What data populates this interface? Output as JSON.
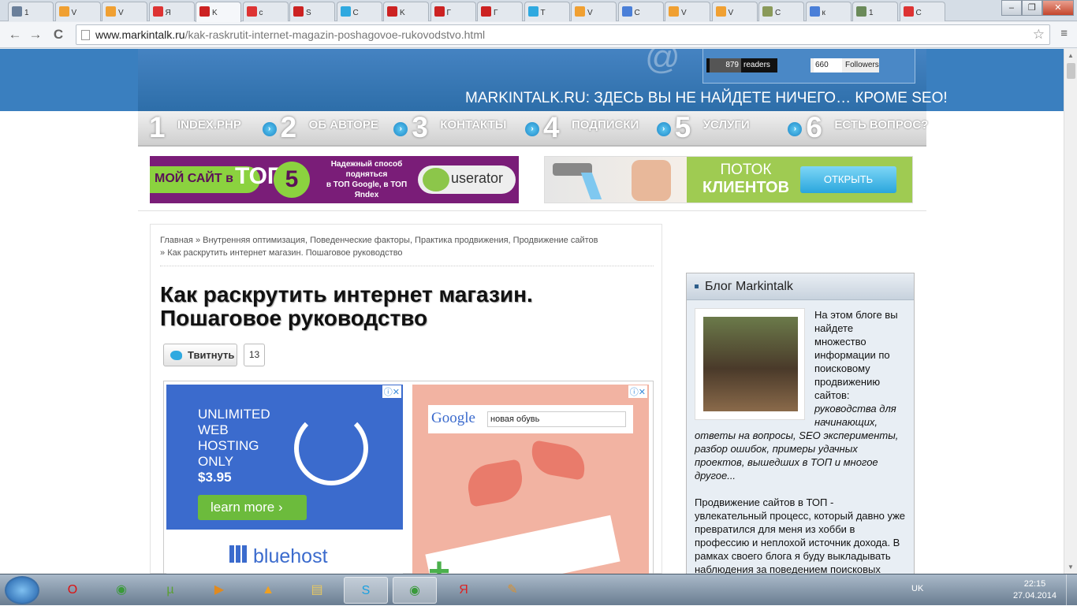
{
  "browser": {
    "tabs": [
      {
        "label": "1",
        "favicon": "#6a7f9a",
        "active": false
      },
      {
        "label": "V",
        "favicon": "#f0a032",
        "active": false
      },
      {
        "label": "V",
        "favicon": "#f0a032",
        "active": false
      },
      {
        "label": "Я",
        "favicon": "#d33",
        "active": false
      },
      {
        "label": "K",
        "favicon": "#c22",
        "active": true
      },
      {
        "label": "c",
        "favicon": "#d33",
        "active": false
      },
      {
        "label": "S",
        "favicon": "#c22",
        "active": false
      },
      {
        "label": "C",
        "favicon": "#2fa9e0",
        "active": false
      },
      {
        "label": "K",
        "favicon": "#c22",
        "active": false
      },
      {
        "label": "Г",
        "favicon": "#c22",
        "active": false
      },
      {
        "label": "Г",
        "favicon": "#c22",
        "active": false
      },
      {
        "label": "Т",
        "favicon": "#2fa9e0",
        "active": false
      },
      {
        "label": "V",
        "favicon": "#f0a032",
        "active": false
      },
      {
        "label": "C",
        "favicon": "#4a7fd8",
        "active": false
      },
      {
        "label": "V",
        "favicon": "#f0a032",
        "active": false
      },
      {
        "label": "V",
        "favicon": "#f0a032",
        "active": false
      },
      {
        "label": "C",
        "favicon": "#8a9a5a",
        "active": false
      },
      {
        "label": "к",
        "favicon": "#4a7fd8",
        "active": false
      },
      {
        "label": "1",
        "favicon": "#6a8a5a",
        "active": false
      },
      {
        "label": "С",
        "favicon": "#d33",
        "active": false
      }
    ],
    "url_host": "www.markintalk.ru",
    "url_path": "/kak-raskrutit-internet-magazin-poshagovoe-rukovodstvo.html",
    "star_icon": "☆",
    "menu_icon": "≡",
    "back_icon": "←",
    "forward_icon": "→",
    "reload_icon": "C",
    "win_min": "–",
    "win_max": "❐",
    "win_close": "✕"
  },
  "header": {
    "rss_count": "879",
    "rss_label": "readers",
    "tw_count": "660",
    "tw_label": "Followers",
    "slogan": "MARKINTALK.RU: ЗДЕСЬ ВЫ НЕ НАЙДЕТЕ НИЧЕГО… КРОМЕ SEO!"
  },
  "nav": [
    {
      "num": "1",
      "label": "INDEX.PHP"
    },
    {
      "num": "2",
      "label": "ОБ АВТОРЕ"
    },
    {
      "num": "3",
      "label": "КОНТАКТЫ"
    },
    {
      "num": "4",
      "label": "ПОДПИСКИ"
    },
    {
      "num": "5",
      "label": "УСЛУГИ"
    },
    {
      "num": "6",
      "label": "ЕСТЬ ВОПРОС?"
    }
  ],
  "banner_left": {
    "pill": "МОЙ САЙТ в",
    "top": "ТОП",
    "five": "5",
    "desc1": "Надежный способ",
    "desc2": "подняться",
    "desc3": "в ТОП Google, в ТОП Яndex",
    "brand": "userator"
  },
  "banner_right": {
    "line1": "ПОТОК",
    "line2": "КЛИЕНТОВ",
    "button": "ОТКРЫТЬ"
  },
  "post": {
    "crumb_home": "Главная",
    "crumb_cats": "Внутренняя оптимизация, Поведенческие факторы, Практика продвижения, Продвижение сайтов",
    "crumb_current": "Как раскрутить интернет магазин. Пошаговое руководство",
    "sep": "»",
    "title": "Как раскрутить интернет магазин. Пошаговое руководство",
    "tweet_label": "Твитнуть",
    "tweet_count": "13"
  },
  "ad1": {
    "line1": "UNLIMITED",
    "line2": "WEB",
    "line3": "HOSTING",
    "line4": "ONLY",
    "price": "$3.95",
    "button": "learn more ›",
    "brand": "bluehost",
    "adchoice": "ⓘ✕"
  },
  "ad2": {
    "google": "Google",
    "query": "новая обувь",
    "adchoice": "ⓘ✕"
  },
  "sidebar": {
    "title": "Блог Markintalk",
    "p1_start": "На этом блоге вы найдете множество информации по поисковому продвижению сайтов: ",
    "p1_em": "руководства для начинающих, ответы на вопросы, SEO эксперименты, разбор ошибок, примеры удачных проектов, вышедших в ТОП и многое другое...",
    "p2": "Продвижение сайтов в ТОП - увлекательный процесс, который давно уже превратился для меня из хобби в профессию и неплохой источник дохода. В рамках своего блога я буду выкладывать наблюдения за поведением поисковых систем, описывать свой опыт продвижения в конкурентных"
  },
  "taskbar": {
    "lang": "UK",
    "time": "22:15",
    "date": "27.04.2014",
    "apps": [
      {
        "name": "opera",
        "glyph": "O",
        "color": "#d11"
      },
      {
        "name": "chrome",
        "glyph": "◉",
        "color": "#3a9a3a"
      },
      {
        "name": "utorrent",
        "glyph": "µ",
        "color": "#5aa032"
      },
      {
        "name": "media-player",
        "glyph": "▶",
        "color": "#e08a20"
      },
      {
        "name": "aimp",
        "glyph": "▲",
        "color": "#f0a020"
      },
      {
        "name": "explorer",
        "glyph": "▤",
        "color": "#e8c860"
      },
      {
        "name": "skype",
        "glyph": "S",
        "color": "#1aa0e0"
      },
      {
        "name": "chrome-active",
        "glyph": "◉",
        "color": "#3a9a3a"
      },
      {
        "name": "yandex",
        "glyph": "Я",
        "color": "#d22"
      },
      {
        "name": "paint",
        "glyph": "✎",
        "color": "#d89030"
      }
    ]
  }
}
